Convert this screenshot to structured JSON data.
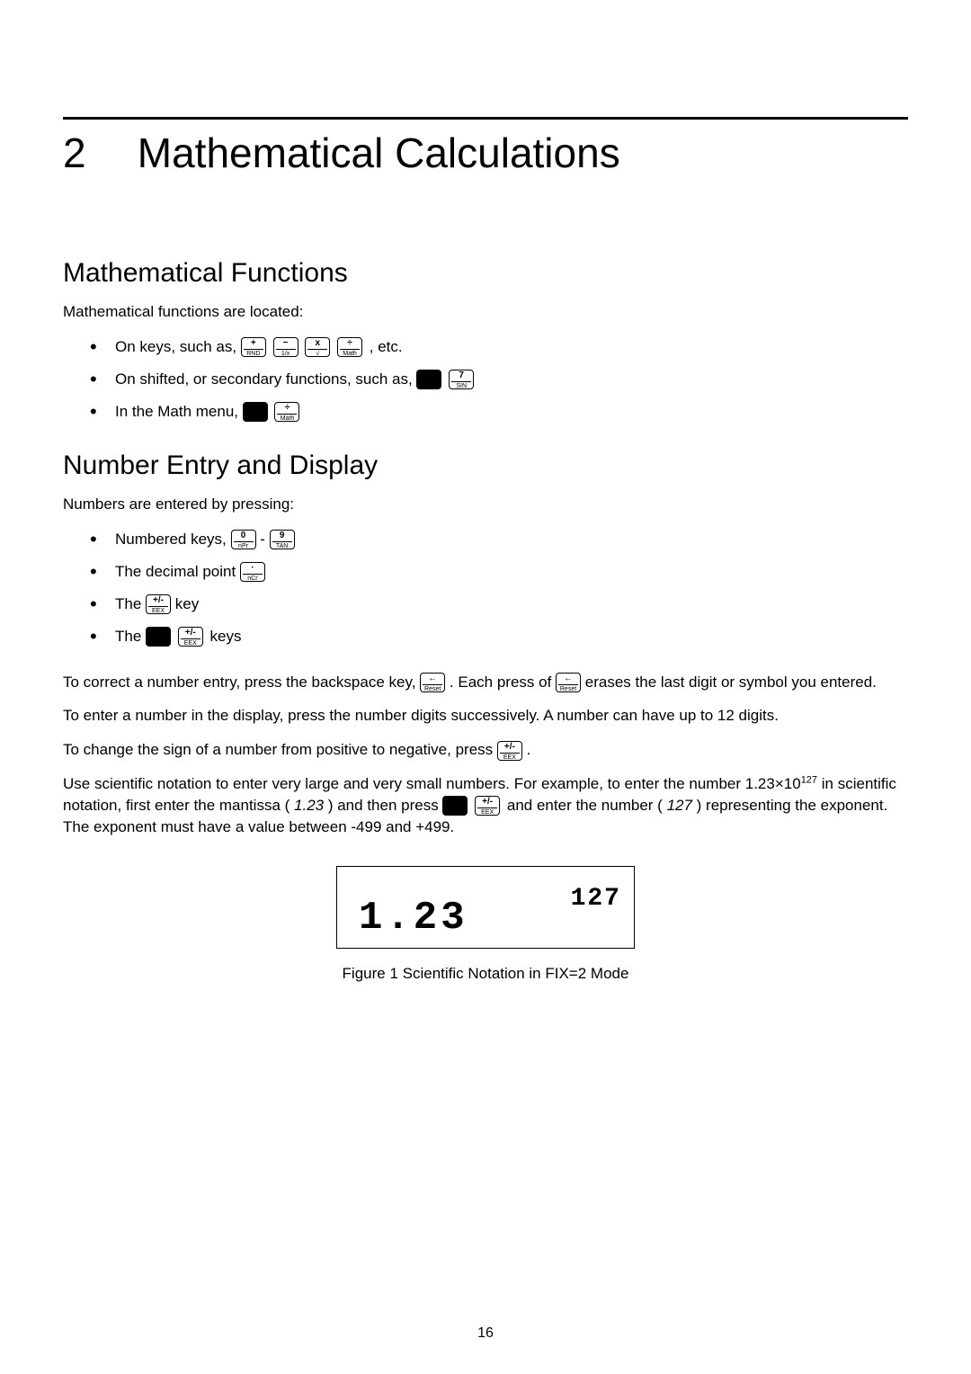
{
  "chapter_number": "2",
  "chapter_title": "Mathematical Calculations",
  "section1_title": "Mathematical Functions",
  "section1_intro": "Mathematical functions are located:",
  "s1_li1_a": "On keys, such as, ",
  "s1_li1_b": " , etc.",
  "s1_li2_a": "On shifted, or secondary functions, such as, ",
  "s1_li3_a": "In the Math menu, ",
  "section2_title": "Number Entry and Display",
  "section2_intro": "Numbers are entered by pressing:",
  "s2_li1_a": "Numbered keys, ",
  "s2_li1_dash": " - ",
  "s2_li2_a": "The decimal point ",
  "s2_li3_a": "The ",
  "s2_li3_b": "  key",
  "s2_li4_a": "The ",
  "s2_li4_b": " keys",
  "p_backspace_a": "To correct a number entry, press the backspace key, ",
  "p_backspace_b": ". Each press of ",
  "p_backspace_c": " erases the last digit or symbol you entered.",
  "p_digits": "To enter a number in the display, press the number digits successively. A number can have up to 12 digits.",
  "p_sign_a": "To change the sign of a number from positive to negative, press ",
  "p_sign_b": ".",
  "p_sci_a": "Use scientific notation to enter very large and very small numbers. For example, to enter the number ",
  "p_sci_num1": "1.23",
  "p_sci_times": "×10",
  "p_sci_exp": "127",
  "p_sci_b": " in scientific notation, first enter the mantissa (",
  "p_sci_mantissa": "1.23 ",
  "p_sci_c": ") and then press ",
  "p_sci_d": " and enter the number (",
  "p_sci_exponent_italic": "127 ",
  "p_sci_e": ") representing the exponent. The exponent must have a value between -499 and +499.",
  "lcd_main": "1.23",
  "lcd_exp": "127",
  "caption": "Figure 1 Scientific Notation in FIX=2 Mode",
  "page_number": "16",
  "keys": {
    "plus_t": "+",
    "plus_b": "RND",
    "minus_t": "−",
    "minus_b": "1/x",
    "mult_t": "x",
    "mult_b": "√",
    "div_t": "÷",
    "div_b": "Math",
    "seven_t": "7",
    "seven_b": "SIN",
    "zero_t": "0",
    "zero_b": "nPr",
    "nine_t": "9",
    "nine_b": "TAN",
    "dot_t": "·",
    "dot_b": "nCr",
    "pm_t": "+/-",
    "pm_b": "EEX",
    "eex_t": "+/-",
    "eex_b": "EEX",
    "back_t": "←",
    "back_b": "Reset"
  }
}
